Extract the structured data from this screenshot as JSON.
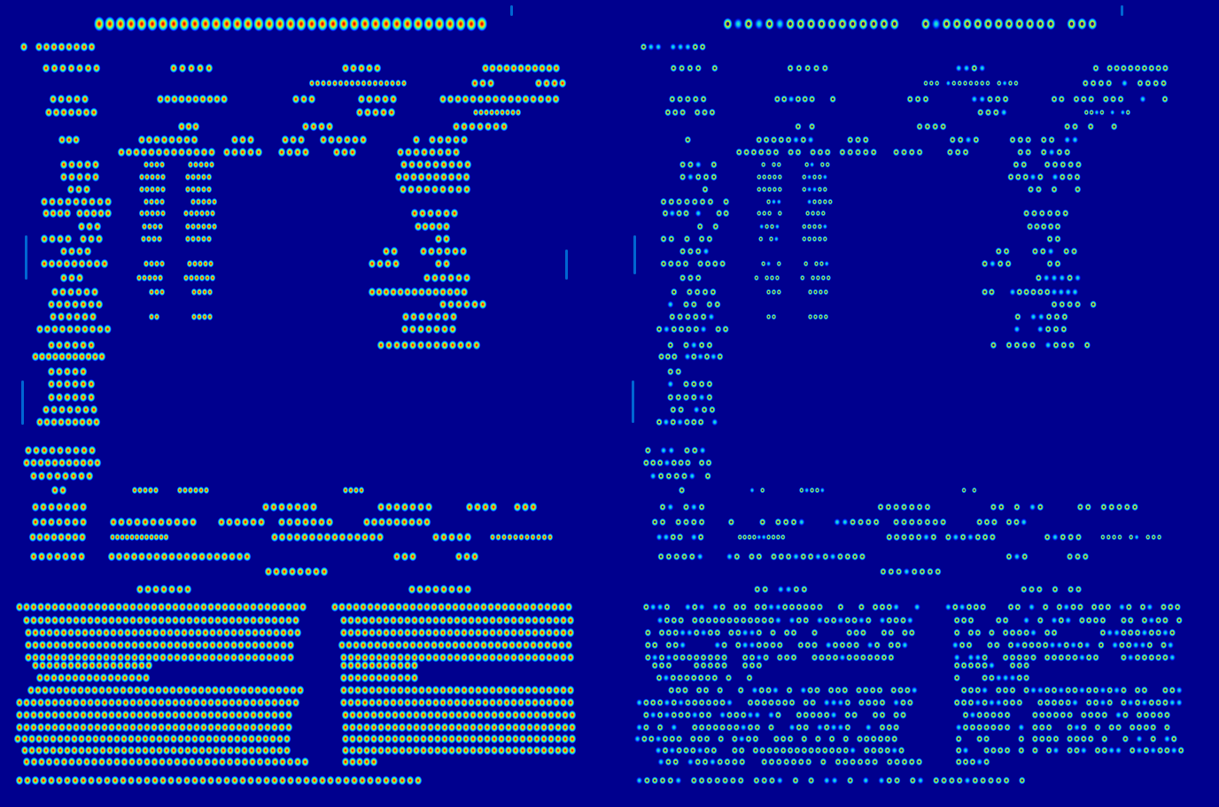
{
  "figure": {
    "colormap": "jet",
    "background_color": "#00008e",
    "panels": [
      {
        "label": "",
        "intensity": "strong"
      },
      {
        "label": "",
        "intensity": "weak"
      }
    ],
    "colors": {
      "peak": "#a00000",
      "high": "#ff2a00",
      "mid_high": "#ffd800",
      "mid": "#3cff9a",
      "mid_low": "#00aaff",
      "low": "#0010ff",
      "base": "#00008e"
    }
  }
}
